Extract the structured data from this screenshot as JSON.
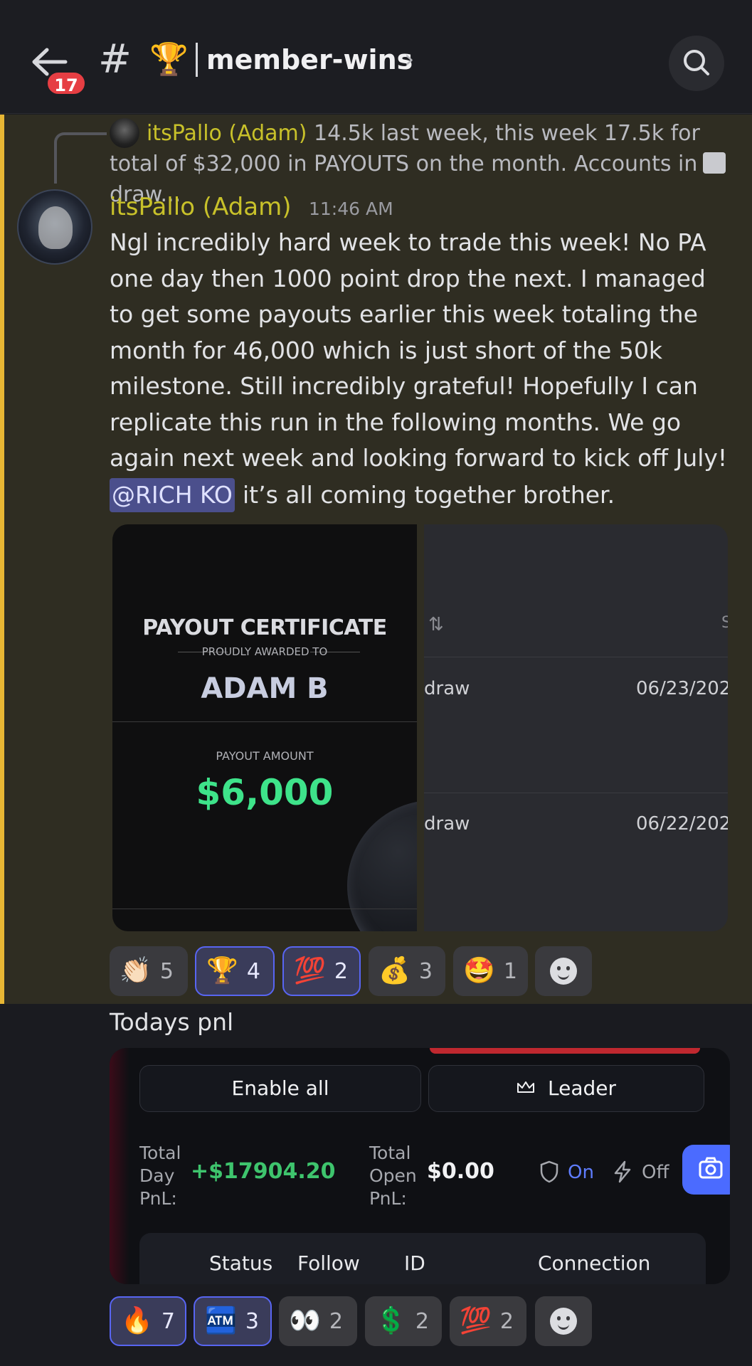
{
  "header": {
    "unread_count": "17",
    "channel_prefix": "#",
    "channel_emoji": "🏆",
    "channel_name": "member-wins",
    "chevron": "›"
  },
  "reply": {
    "author": "itsPallo (Adam)",
    "text": "14.5k last week, this week 17.5k for total of $32,000 in PAYOUTS on the month. Accounts in draw..."
  },
  "message": {
    "author": "itsPallo (Adam)",
    "time": "11:46 AM",
    "body": "Ngl incredibly hard week to trade this week! No PA one day then 1000 point drop the next. I managed to get some payouts earlier this week totaling the month for 46,000 which is just short of the 50k milestone. Still incredibly grateful! Hopefully I can replicate this run in the following months. We go again next week and looking forward to kick off July!",
    "mention": "@RICH KO",
    "tail": "it’s all coming together brother."
  },
  "certificate": {
    "title": "PAYOUT CERTIFICATE",
    "subtitle": "PROUDLY AWARDED TO",
    "name": "ADAM B",
    "amount_label": "PAYOUT AMOUNT",
    "amount": "$6,000"
  },
  "table_image": {
    "sort_icon": "⇅",
    "col_fragment": "S",
    "rows": [
      {
        "type": "draw",
        "date": "06/23/202"
      },
      {
        "type": "draw",
        "date": "06/22/202"
      }
    ]
  },
  "reactions_1": [
    {
      "emoji": "👏🏻",
      "count": "5",
      "active": false
    },
    {
      "emoji": "🏆",
      "count": "4",
      "active": true
    },
    {
      "emoji": "💯",
      "count": "2",
      "active": true
    },
    {
      "emoji": "💰",
      "count": "3",
      "active": false
    },
    {
      "emoji": "🤩",
      "count": "1",
      "active": false
    }
  ],
  "message2": {
    "body": "Todays pnl"
  },
  "pnl": {
    "enable_all": "Enable all",
    "leader": "Leader",
    "day_label_1": "Total",
    "day_label_2": "Day",
    "day_label_3": "PnL:",
    "day_value": "+$17904.20",
    "open_label_1": "Total",
    "open_label_2": "Open",
    "open_label_3": "PnL:",
    "open_value": "$0.00",
    "on": "On",
    "off": "Off",
    "headers": [
      "Status",
      "Follow",
      "ID",
      "Connection"
    ]
  },
  "reactions_2": [
    {
      "emoji": "🔥",
      "count": "7",
      "active": true
    },
    {
      "emoji": "🏧",
      "count": "3",
      "active": true
    },
    {
      "emoji": "👀",
      "count": "2",
      "active": false
    },
    {
      "emoji": "💲",
      "count": "2",
      "active": false
    },
    {
      "emoji": "💯",
      "count": "2",
      "active": false
    }
  ],
  "colors": {
    "accent": "#5865f2",
    "highlight_bar": "#e7b634",
    "author": "#c8c12a",
    "payout_green": "#3ee38a",
    "pnl_green": "#3ec46d"
  }
}
